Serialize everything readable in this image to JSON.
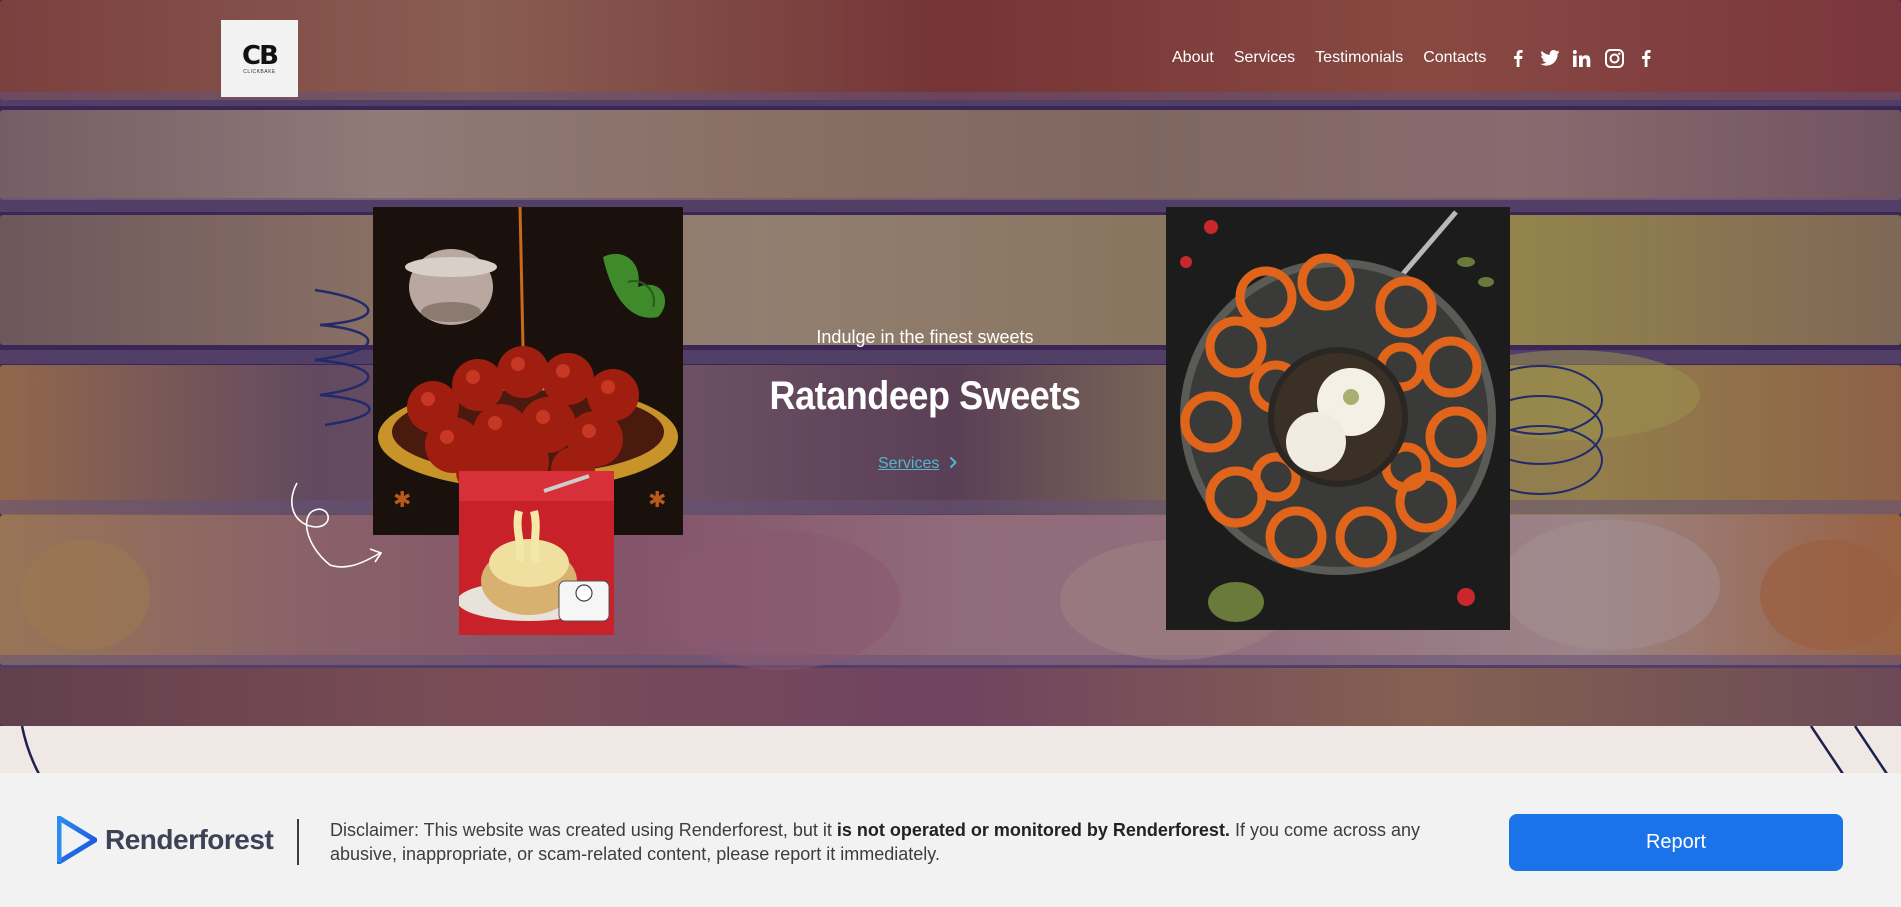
{
  "header": {
    "logo_text": "CB",
    "logo_sub": "CLICKBAKE",
    "nav": [
      "About",
      "Services",
      "Testimonials",
      "Contacts"
    ],
    "social_icons": [
      "facebook-icon",
      "twitter-icon",
      "linkedin-icon",
      "instagram-icon",
      "facebook-icon"
    ]
  },
  "hero": {
    "tagline": "Indulge in the finest sweets",
    "title": "Ratandeep Sweets",
    "services_link": "Services",
    "images": [
      "gulab-jamun-photo",
      "sweet-bun-photo",
      "jalebi-photo"
    ]
  },
  "disclaimer": {
    "brand": "Renderforest",
    "text_before": "Disclaimer: This website was created using Renderforest, but it ",
    "text_bold": "is not operated or monitored by Renderforest.",
    "text_after": " If you come across any abusive, inappropriate, or scam-related content, please report it immediately.",
    "report_label": "Report"
  },
  "colors": {
    "accent": "#4fb8c9",
    "report_button": "#1a73e8",
    "section_bg": "#f0e8e4",
    "disclaimer_bg": "#f2f2f2"
  }
}
